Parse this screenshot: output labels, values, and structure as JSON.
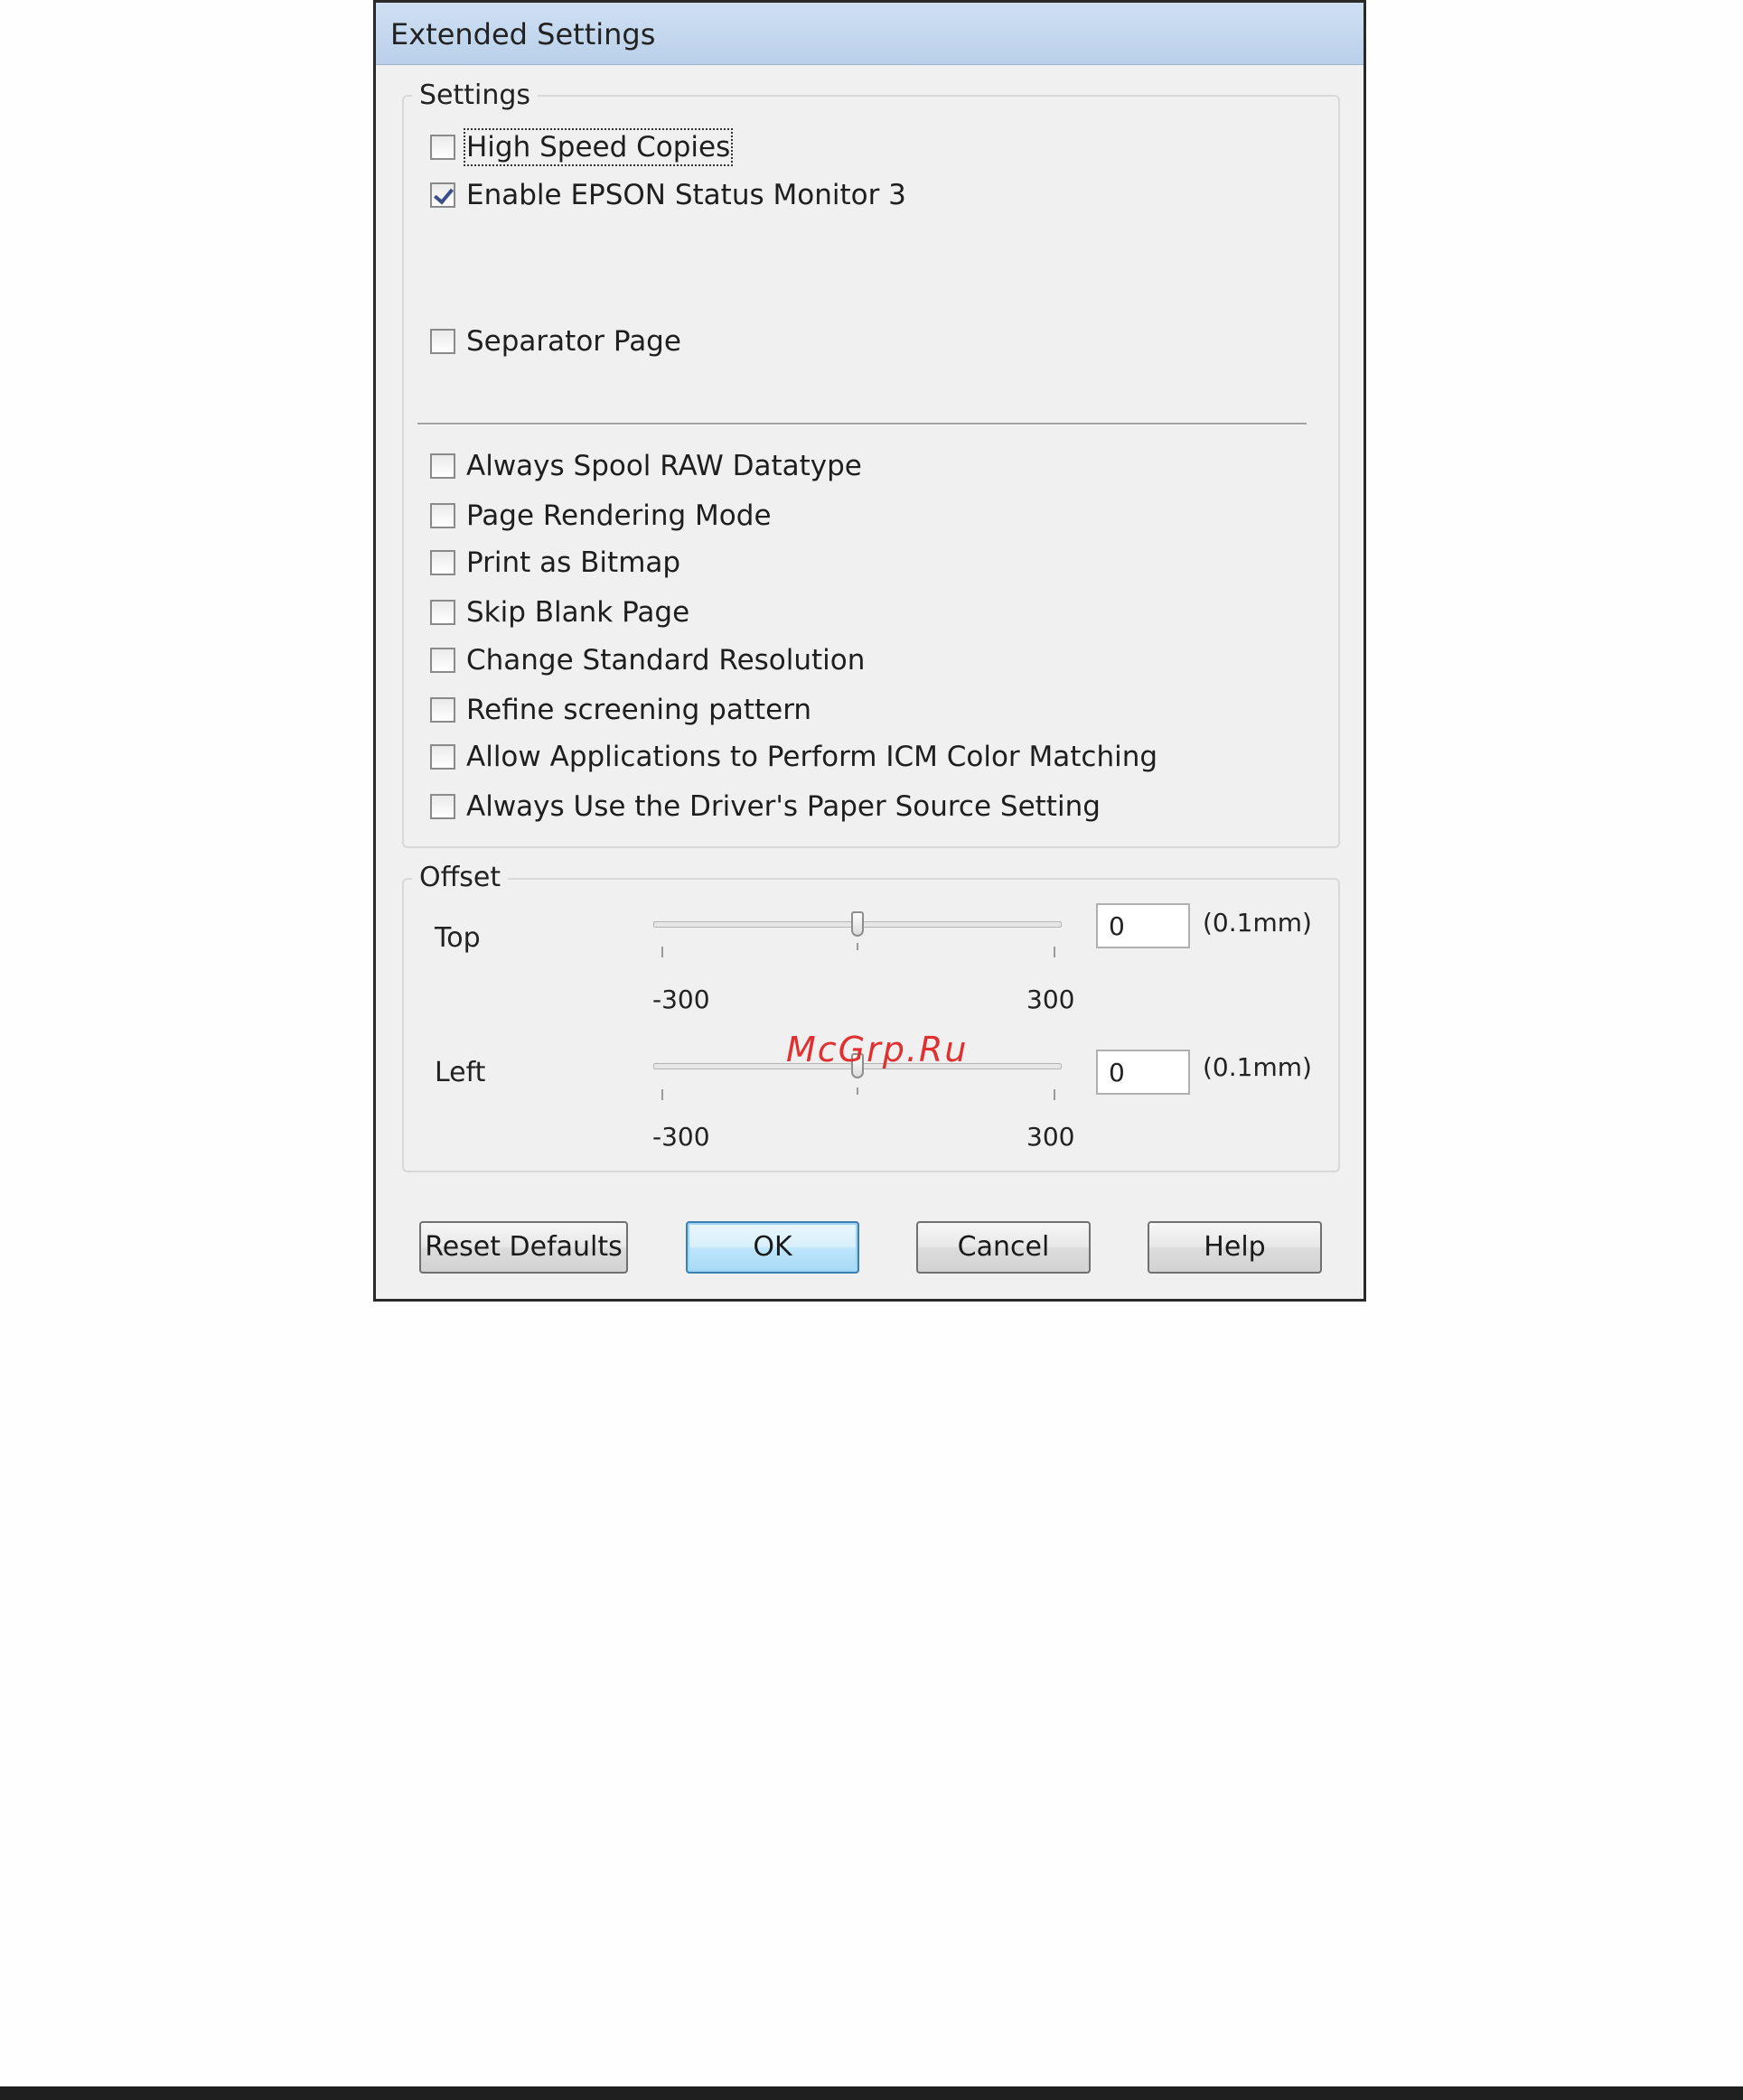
{
  "window": {
    "title": "Extended Settings"
  },
  "settings_group": {
    "legend": "Settings",
    "checkboxes_top": [
      {
        "label": "High Speed Copies",
        "checked": false
      },
      {
        "label": "Enable EPSON Status Monitor 3",
        "checked": true
      },
      {
        "label": "Separator Page",
        "checked": false
      }
    ],
    "checkboxes_bottom": [
      {
        "label": "Always Spool RAW Datatype",
        "checked": false
      },
      {
        "label": "Page Rendering Mode",
        "checked": false
      },
      {
        "label": "Print as Bitmap",
        "checked": false
      },
      {
        "label": "Skip Blank Page",
        "checked": false
      },
      {
        "label": "Change Standard Resolution",
        "checked": false
      },
      {
        "label": "Refine screening pattern",
        "checked": false
      },
      {
        "label": "Allow Applications to Perform ICM Color Matching",
        "checked": false
      },
      {
        "label": "Always Use the Driver's Paper Source Setting",
        "checked": false
      }
    ]
  },
  "offset_group": {
    "legend": "Offset",
    "top": {
      "label": "Top",
      "value": "0",
      "min_label": "-300",
      "max_label": "300",
      "unit": "(0.1mm)",
      "slider_value": 0
    },
    "left": {
      "label": "Left",
      "value": "0",
      "min_label": "-300",
      "max_label": "300",
      "unit": "(0.1mm)",
      "slider_value": 0
    }
  },
  "buttons": {
    "reset": "Reset Defaults",
    "ok": "OK",
    "cancel": "Cancel",
    "help": "Help"
  },
  "watermark": "McGrp.Ru",
  "colors": {
    "titlebar": "#c4d8ee",
    "default_button": "#bee6fd",
    "check": "#3a4f8a"
  }
}
